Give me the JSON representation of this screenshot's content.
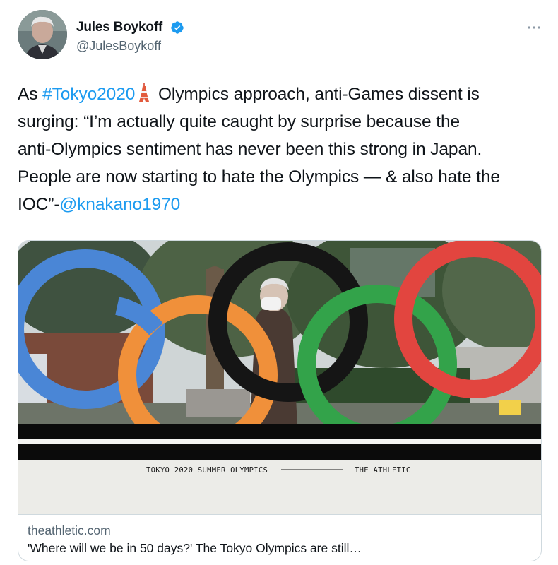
{
  "author": {
    "name": "Jules Boykoff",
    "handle": "@JulesBoykoff",
    "verified": true
  },
  "tweet": {
    "line1_pre": "As ",
    "hashtag": "#Tokyo2020",
    "line1_post": " Olympics approach, anti-Games dissent is",
    "line2": "surging: “I’m actually quite caught by surprise because the",
    "line3": "anti-Olympics sentiment has never been this strong in Japan.",
    "line4": "People are now starting to hate the Olympics — & also hate the",
    "line5_pre": "IOC”-",
    "mention": "@knakano1970"
  },
  "card": {
    "banner_left": "TOKYO 2020 SUMMER OLYMPICS",
    "banner_right": "THE ATHLETIC",
    "domain": "theathletic.com",
    "title": "'Where will we be in 50 days?' The Tokyo Olympics are still…"
  },
  "icons": {
    "more": "more-horizontal-icon",
    "verified": "verified-badge-icon",
    "emoji": "tokyo-tower-emoji"
  },
  "colors": {
    "link": "#1d9bf0",
    "verified": "#1d9bf0",
    "secondary_text": "#536471",
    "ring_blue": "#4a86d6",
    "ring_orange": "#f0903a",
    "ring_black": "#151515",
    "ring_green": "#33a34a",
    "ring_red": "#e2453f"
  }
}
